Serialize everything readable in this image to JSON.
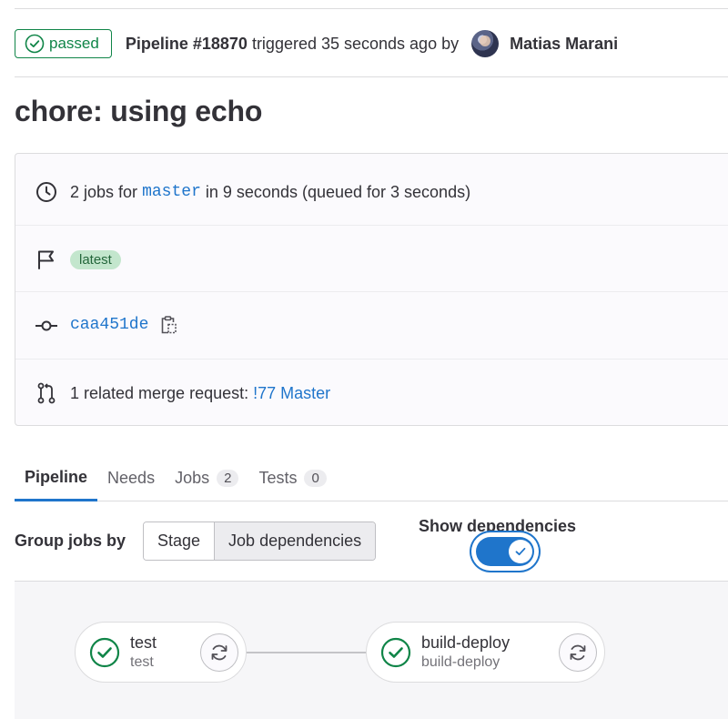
{
  "header": {
    "status_label": "passed",
    "pipeline_label": "Pipeline #18870",
    "triggered_text": "triggered 35 seconds ago by",
    "author_name": "Matias Marani"
  },
  "commit": {
    "title": "chore: using echo"
  },
  "info": {
    "jobs_prefix": "2 jobs for",
    "branch": "master",
    "jobs_suffix": "in 9 seconds (queued for 3 seconds)",
    "badge_latest": "latest",
    "commit_sha": "caa451de",
    "mr_prefix": "1 related merge request:",
    "mr_link": "!77 Master"
  },
  "tabs": [
    {
      "label": "Pipeline",
      "count": null,
      "active": true
    },
    {
      "label": "Needs",
      "count": null,
      "active": false
    },
    {
      "label": "Jobs",
      "count": "2",
      "active": false
    },
    {
      "label": "Tests",
      "count": "0",
      "active": false
    }
  ],
  "toolbar": {
    "group_label": "Group jobs by",
    "option_stage": "Stage",
    "option_dependencies": "Job dependencies",
    "selected_option": "Job dependencies",
    "show_dependencies_label": "Show dependencies",
    "show_dependencies_on": true
  },
  "jobs": [
    {
      "name": "test",
      "stage": "test",
      "status": "success"
    },
    {
      "name": "build-deploy",
      "stage": "build-deploy",
      "status": "success"
    }
  ],
  "colors": {
    "success": "#108548",
    "link": "#1f75cb",
    "latest_badge_bg": "#c3e6cd"
  },
  "icons": {
    "status": "status-success-icon",
    "clock": "clock-icon",
    "flag": "flag-icon",
    "commit": "commit-icon",
    "copy": "copy-to-clipboard-icon",
    "merge_request": "merge-request-icon",
    "retry": "retry-icon",
    "check": "check-icon"
  }
}
